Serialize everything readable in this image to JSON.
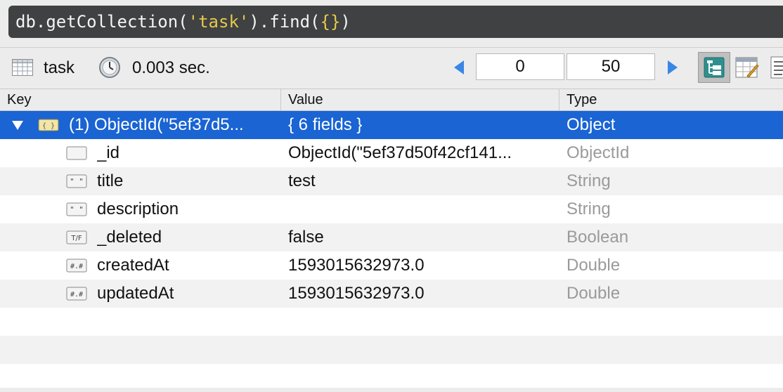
{
  "query": {
    "part1": "db",
    "part2": ".getCollection(",
    "part3": "'task'",
    "part4": ").find(",
    "part5": "{}",
    "part6": ")"
  },
  "toolbar": {
    "collection_name": "task",
    "execution_time": "0.003 sec.",
    "skip_value": "0",
    "limit_value": "50"
  },
  "columns": {
    "key": "Key",
    "value": "Value",
    "type": "Type"
  },
  "root": {
    "key": "(1) ObjectId(\"5ef37d5...",
    "value": "{ 6 fields }",
    "type": "Object"
  },
  "fields": [
    {
      "key": "_id",
      "value": "ObjectId(\"5ef37d50f42cf141...",
      "type": "ObjectId",
      "icon": "id-icon"
    },
    {
      "key": "title",
      "value": "test",
      "type": "String",
      "icon": "string-icon"
    },
    {
      "key": "description",
      "value": "",
      "type": "String",
      "icon": "string-icon"
    },
    {
      "key": "_deleted",
      "value": "false",
      "type": "Boolean",
      "icon": "boolean-icon"
    },
    {
      "key": "createdAt",
      "value": "1593015632973.0",
      "type": "Double",
      "icon": "number-icon"
    },
    {
      "key": "updatedAt",
      "value": "1593015632973.0",
      "type": "Double",
      "icon": "number-icon"
    }
  ],
  "icon_labels": {
    "string": "\" \"",
    "boolean": "T/F",
    "number": "#.#"
  },
  "colors": {
    "selection": "#1a64d3",
    "query_bg": "#3f4142",
    "query_string": "#e6c84b",
    "nav_arrow": "#3a86e6"
  }
}
